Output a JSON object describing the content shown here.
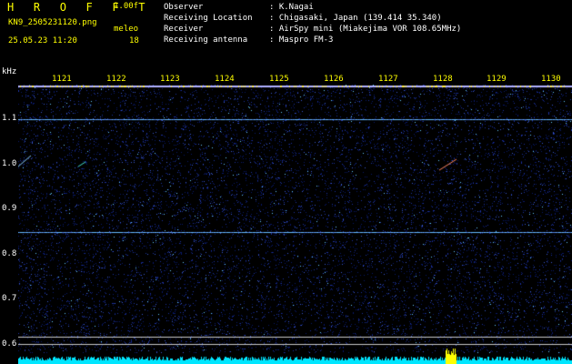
{
  "header": {
    "title": "H R O F F T",
    "version": "1.00f",
    "file_name": "KN9_2505231120.png",
    "detector_name": "meleo",
    "timestamp": "25.05.23 11:20",
    "count": "18"
  },
  "info": [
    {
      "label": "Observer",
      "value": ": K.Nagai"
    },
    {
      "label": "Receiving Location",
      "value": ": Chigasaki, Japan (139.414 35.340)"
    },
    {
      "label": "Receiver",
      "value": ": AirSpy mini (Miakejima VOR 108.65MHz)"
    },
    {
      "label": "Receiving antenna",
      "value": ": Maspro FM-3"
    }
  ],
  "spectrogram": {
    "y_unit": "kHz",
    "x_ticks": [
      "1121",
      "1122",
      "1123",
      "1124",
      "1125",
      "1126",
      "1127",
      "1128",
      "1129",
      "1130"
    ],
    "y_ticks": [
      "1.1",
      "1.0",
      "0.9",
      "0.8",
      "0.7",
      "0.6"
    ],
    "colors": {
      "background": "#000000",
      "text_yellow": "#ffff00",
      "text_white": "#ffffff",
      "noise": "#1e32a0",
      "baseline": "#00e6ff"
    }
  }
}
